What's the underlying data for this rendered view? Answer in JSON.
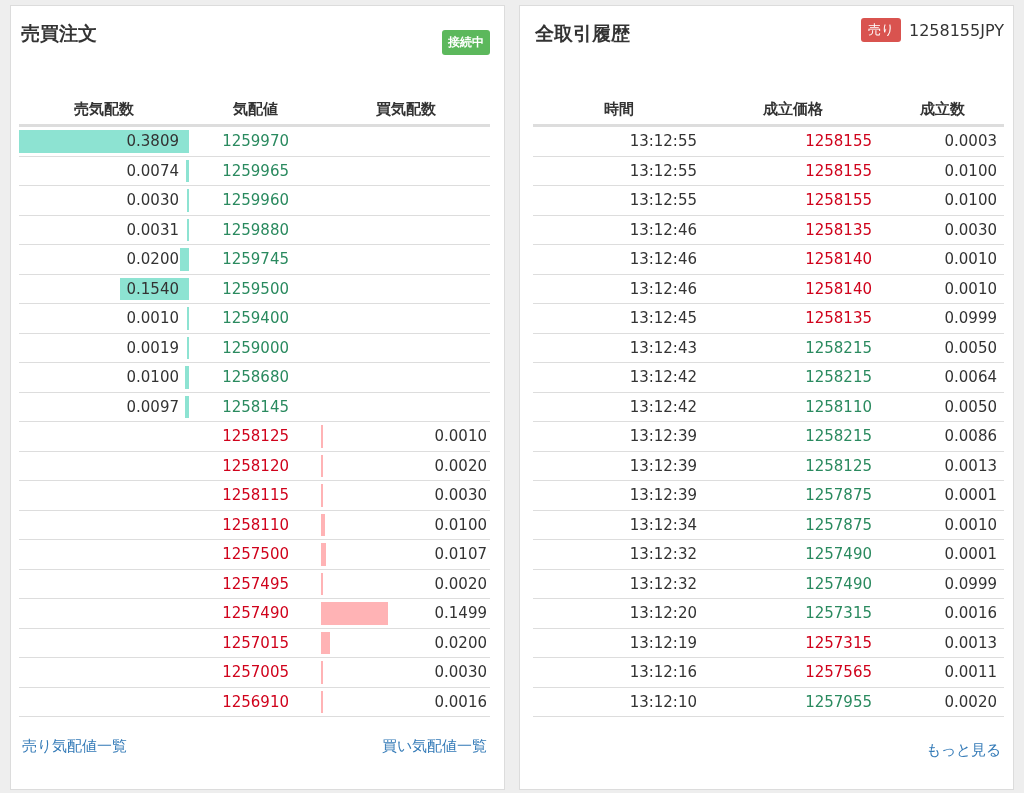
{
  "order_book": {
    "title": "売買注文",
    "status_badge": "接続中",
    "columns": [
      "売気配数",
      "気配値",
      "買気配数"
    ],
    "rows": [
      {
        "kind": "ask",
        "amount": "0.3809",
        "price": "1259970",
        "level": 1.0
      },
      {
        "kind": "ask",
        "amount": "0.0074",
        "price": "1259965",
        "level": 0.019
      },
      {
        "kind": "ask",
        "amount": "0.0030",
        "price": "1259960",
        "level": 0.008
      },
      {
        "kind": "ask",
        "amount": "0.0031",
        "price": "1259880",
        "level": 0.008
      },
      {
        "kind": "ask",
        "amount": "0.0200",
        "price": "1259745",
        "level": 0.053
      },
      {
        "kind": "ask",
        "amount": "0.1540",
        "price": "1259500",
        "level": 0.404
      },
      {
        "kind": "ask",
        "amount": "0.0010",
        "price": "1259400",
        "level": 0.003
      },
      {
        "kind": "ask",
        "amount": "0.0019",
        "price": "1259000",
        "level": 0.005
      },
      {
        "kind": "ask",
        "amount": "0.0100",
        "price": "1258680",
        "level": 0.026
      },
      {
        "kind": "ask",
        "amount": "0.0097",
        "price": "1258145",
        "level": 0.025
      },
      {
        "kind": "bid",
        "amount": "0.0010",
        "price": "1258125",
        "level": 0.003
      },
      {
        "kind": "bid",
        "amount": "0.0020",
        "price": "1258120",
        "level": 0.005
      },
      {
        "kind": "bid",
        "amount": "0.0030",
        "price": "1258115",
        "level": 0.008
      },
      {
        "kind": "bid",
        "amount": "0.0100",
        "price": "1258110",
        "level": 0.026
      },
      {
        "kind": "bid",
        "amount": "0.0107",
        "price": "1257500",
        "level": 0.028
      },
      {
        "kind": "bid",
        "amount": "0.0020",
        "price": "1257495",
        "level": 0.005
      },
      {
        "kind": "bid",
        "amount": "0.1499",
        "price": "1257490",
        "level": 0.394
      },
      {
        "kind": "bid",
        "amount": "0.0200",
        "price": "1257015",
        "level": 0.053
      },
      {
        "kind": "bid",
        "amount": "0.0030",
        "price": "1257005",
        "level": 0.008
      },
      {
        "kind": "bid",
        "amount": "0.0016",
        "price": "1256910",
        "level": 0.004
      }
    ],
    "links": [
      "売り気配値一覧",
      "買い気配値一覧"
    ]
  },
  "trade_history": {
    "title": "全取引履歴",
    "last_trade": {
      "side_label": "売り",
      "color": "#d9534f",
      "price": "1258155JPY"
    },
    "columns": [
      "時間",
      "成立価格",
      "成立数"
    ],
    "rows": [
      {
        "time": "13:12:55",
        "price": "1258155",
        "amount": "0.0003",
        "color": "#d0021b"
      },
      {
        "time": "13:12:55",
        "price": "1258155",
        "amount": "0.0100",
        "color": "#d0021b"
      },
      {
        "time": "13:12:55",
        "price": "1258155",
        "amount": "0.0100",
        "color": "#d0021b"
      },
      {
        "time": "13:12:46",
        "price": "1258135",
        "amount": "0.0030",
        "color": "#d0021b"
      },
      {
        "time": "13:12:46",
        "price": "1258140",
        "amount": "0.0010",
        "color": "#d0021b"
      },
      {
        "time": "13:12:46",
        "price": "1258140",
        "amount": "0.0010",
        "color": "#d0021b"
      },
      {
        "time": "13:12:45",
        "price": "1258135",
        "amount": "0.0999",
        "color": "#d0021b"
      },
      {
        "time": "13:12:43",
        "price": "1258215",
        "amount": "0.0050",
        "color": "#2a8a5f"
      },
      {
        "time": "13:12:42",
        "price": "1258215",
        "amount": "0.0064",
        "color": "#2a8a5f"
      },
      {
        "time": "13:12:42",
        "price": "1258110",
        "amount": "0.0050",
        "color": "#2a8a5f"
      },
      {
        "time": "13:12:39",
        "price": "1258215",
        "amount": "0.0086",
        "color": "#2a8a5f"
      },
      {
        "time": "13:12:39",
        "price": "1258125",
        "amount": "0.0013",
        "color": "#2a8a5f"
      },
      {
        "time": "13:12:39",
        "price": "1257875",
        "amount": "0.0001",
        "color": "#2a8a5f"
      },
      {
        "time": "13:12:34",
        "price": "1257875",
        "amount": "0.0010",
        "color": "#2a8a5f"
      },
      {
        "time": "13:12:32",
        "price": "1257490",
        "amount": "0.0001",
        "color": "#2a8a5f"
      },
      {
        "time": "13:12:32",
        "price": "1257490",
        "amount": "0.0999",
        "color": "#2a8a5f"
      },
      {
        "time": "13:12:20",
        "price": "1257315",
        "amount": "0.0016",
        "color": "#2a8a5f"
      },
      {
        "time": "13:12:19",
        "price": "1257315",
        "amount": "0.0013",
        "color": "#d0021b"
      },
      {
        "time": "13:12:16",
        "price": "1257565",
        "amount": "0.0011",
        "color": "#d0021b"
      },
      {
        "time": "13:12:10",
        "price": "1257955",
        "amount": "0.0020",
        "color": "#2a8a5f"
      }
    ],
    "more_link": "もっと見る"
  }
}
